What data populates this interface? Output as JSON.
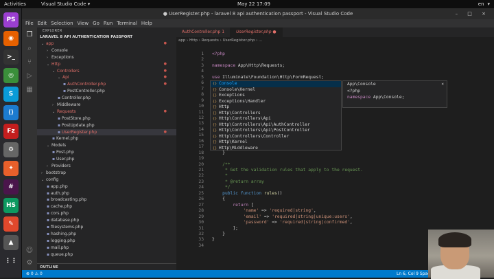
{
  "topbar": {
    "activities": "Activities",
    "app": "Visual Studio Code ▾",
    "clock": "May 22  17:09",
    "tray": [
      "en",
      "▾"
    ]
  },
  "title": "● UserRegister.php - laravel 8 api authentication passport - Visual Studio Code",
  "menu": [
    "File",
    "Edit",
    "Selection",
    "View",
    "Go",
    "Run",
    "Terminal",
    "Help"
  ],
  "explorer": {
    "header": "EXPLORER",
    "project": "LARAVEL 8 API AUTHENTICATION PASSPORT",
    "outline": "OUTLINE"
  },
  "tree": [
    {
      "label": "app",
      "depth": 0,
      "arrow": "⌄",
      "red": true,
      "dot": true
    },
    {
      "label": "Console",
      "depth": 1,
      "arrow": "›"
    },
    {
      "label": "Exceptions",
      "depth": 1,
      "arrow": "›"
    },
    {
      "label": "Http",
      "depth": 1,
      "arrow": "⌄",
      "red": true,
      "dot": true
    },
    {
      "label": "Controllers",
      "depth": 2,
      "arrow": "⌄",
      "red": true,
      "dot": true
    },
    {
      "label": "Api",
      "depth": 3,
      "arrow": "⌄",
      "red": true,
      "dot": true
    },
    {
      "label": "AuthController.php",
      "depth": 4,
      "file": true,
      "red": true,
      "dot": true
    },
    {
      "label": "PostController.php",
      "depth": 4,
      "file": true
    },
    {
      "label": "Controller.php",
      "depth": 3,
      "file": true
    },
    {
      "label": "Middleware",
      "depth": 2,
      "arrow": "›"
    },
    {
      "label": "Requests",
      "depth": 2,
      "arrow": "⌄",
      "red": true,
      "dot": true
    },
    {
      "label": "PostStore.php",
      "depth": 3,
      "file": true
    },
    {
      "label": "PostUpdate.php",
      "depth": 3,
      "file": true
    },
    {
      "label": "UserRegister.php",
      "depth": 3,
      "file": true,
      "red": true,
      "dot": true,
      "selected": true
    },
    {
      "label": "Kernel.php",
      "depth": 2,
      "file": true
    },
    {
      "label": "Models",
      "depth": 1,
      "arrow": "⌄"
    },
    {
      "label": "Post.php",
      "depth": 2,
      "file": true
    },
    {
      "label": "User.php",
      "depth": 2,
      "file": true
    },
    {
      "label": "Providers",
      "depth": 1,
      "arrow": "›"
    },
    {
      "label": "bootstrap",
      "depth": 0,
      "arrow": "›"
    },
    {
      "label": "config",
      "depth": 0,
      "arrow": "⌄"
    },
    {
      "label": "app.php",
      "depth": 1,
      "file": true
    },
    {
      "label": "auth.php",
      "depth": 1,
      "file": true
    },
    {
      "label": "broadcasting.php",
      "depth": 1,
      "file": true
    },
    {
      "label": "cache.php",
      "depth": 1,
      "file": true
    },
    {
      "label": "cors.php",
      "depth": 1,
      "file": true
    },
    {
      "label": "database.php",
      "depth": 1,
      "file": true
    },
    {
      "label": "filesystems.php",
      "depth": 1,
      "file": true
    },
    {
      "label": "hashing.php",
      "depth": 1,
      "file": true
    },
    {
      "label": "logging.php",
      "depth": 1,
      "file": true
    },
    {
      "label": "mail.php",
      "depth": 1,
      "file": true
    },
    {
      "label": "queue.php",
      "depth": 1,
      "file": true
    }
  ],
  "tabs": [
    {
      "label": "AuthController.php  1",
      "active": false
    },
    {
      "label": "UserRegister.php  ●",
      "active": true
    }
  ],
  "breadcrumb": "app › Http › Requests › UserRegister.php › ...",
  "code": [
    [
      [
        "<?php",
        "ph"
      ]
    ],
    [],
    [
      [
        "namespace ",
        "kw"
      ],
      [
        "App\\Http\\Requests;",
        ""
      ]
    ],
    [],
    [
      [
        "use ",
        "kw"
      ],
      [
        "Illuminate\\Foundation\\Http\\FormRequest;",
        ""
      ]
    ],
    [
      [
        "use ",
        "kw"
      ],
      [
        "App\\",
        ""
      ]
    ],
    [],
    [
      [
        "class Us",
        ""
      ]
    ],
    [
      [
        "{",
        ""
      ]
    ],
    [
      [
        "    /**",
        "cm"
      ]
    ],
    [
      [
        "     * D",
        "cm"
      ]
    ],
    [
      [
        "     *",
        "cm"
      ]
    ],
    [
      [
        "     * @",
        "cm"
      ]
    ],
    [
      [
        "     */",
        "cm"
      ]
    ],
    [
      [
        "    publ",
        "kw2"
      ]
    ],
    [
      [
        "    {",
        ""
      ]
    ],
    [
      [
        "        ",
        ""
      ]
    ],
    [
      [
        "    }",
        ""
      ]
    ],
    [],
    [
      [
        "    /**",
        "cm"
      ]
    ],
    [
      [
        "     * Get the validation rules that apply to the request.",
        "cm"
      ]
    ],
    [
      [
        "     *",
        "cm"
      ]
    ],
    [
      [
        "     * @return array",
        "cm"
      ]
    ],
    [
      [
        "     */",
        "cm"
      ]
    ],
    [
      [
        "    public ",
        "kw2"
      ],
      [
        "function ",
        "kw2"
      ],
      [
        "rules",
        "fn"
      ],
      [
        "()",
        ""
      ]
    ],
    [
      [
        "    {",
        ""
      ]
    ],
    [
      [
        "        return ",
        "kw"
      ],
      [
        "[",
        ""
      ]
    ],
    [
      [
        "            ",
        ""
      ],
      [
        "'name'",
        "st"
      ],
      [
        " => ",
        ""
      ],
      [
        "'required|string'",
        "st"
      ],
      [
        ",",
        ""
      ]
    ],
    [
      [
        "            ",
        ""
      ],
      [
        "'email'",
        "st"
      ],
      [
        " => ",
        ""
      ],
      [
        "'required|string|unique:users'",
        "st"
      ],
      [
        ",",
        ""
      ]
    ],
    [
      [
        "            ",
        ""
      ],
      [
        "'password'",
        "st"
      ],
      [
        " => ",
        ""
      ],
      [
        "'required|string|confirmed'",
        "st"
      ],
      [
        ",",
        ""
      ]
    ],
    [
      [
        "        ];",
        ""
      ]
    ],
    [
      [
        "    }",
        ""
      ]
    ],
    [
      [
        "}",
        ""
      ]
    ],
    []
  ],
  "suggestions": [
    "Console",
    "Console\\Kernel",
    "Exceptions",
    "Exceptions\\Handler",
    "Http",
    "Http\\Controllers",
    "Http\\Controllers\\Api",
    "Http\\Controllers\\Api\\AuthController",
    "Http\\Controllers\\Api\\PostController",
    "Http\\Controllers\\Controller",
    "Http\\Kernel",
    "Http\\Middleware"
  ],
  "detail": {
    "title": "App\\Console",
    "lines": [
      "<?php",
      "namespace App\\Console;"
    ],
    "close": "×",
    "overflow": "uest."
  },
  "status": {
    "left": "⊗ 0  ⚠ 0",
    "right": "Ln 6, Col 9    Spaces: 4"
  },
  "dock": [
    {
      "name": "phpstorm-icon",
      "glyph": "PS",
      "color": "#9b3fd1"
    },
    {
      "name": "firefox-icon",
      "glyph": "◉",
      "color": "#e66000"
    },
    {
      "name": "terminal-icon",
      "glyph": ">_",
      "color": "#333"
    },
    {
      "name": "chrome-icon",
      "glyph": "◎",
      "color": "#3a8e3a"
    },
    {
      "name": "skype-icon",
      "glyph": "S",
      "color": "#0a9bd8"
    },
    {
      "name": "vscode-icon",
      "glyph": "⟨⟩",
      "color": "#1c7bcf"
    },
    {
      "name": "filezilla-icon",
      "glyph": "Fz",
      "color": "#c41e1e"
    },
    {
      "name": "settings-icon",
      "glyph": "⚙",
      "color": "#666"
    },
    {
      "name": "postman-icon",
      "glyph": "✦",
      "color": "#e8602b"
    },
    {
      "name": "slack-icon",
      "glyph": "#",
      "color": "#4a154b"
    },
    {
      "name": "hs-icon",
      "glyph": "HS",
      "color": "#0d9960"
    },
    {
      "name": "pen-icon",
      "glyph": "✎",
      "color": "#e0482c"
    },
    {
      "name": "app-icon",
      "glyph": "▲",
      "color": "#555"
    },
    {
      "name": "apps-grid-icon",
      "glyph": "⋮⋮",
      "color": "#2a2a2e"
    }
  ]
}
